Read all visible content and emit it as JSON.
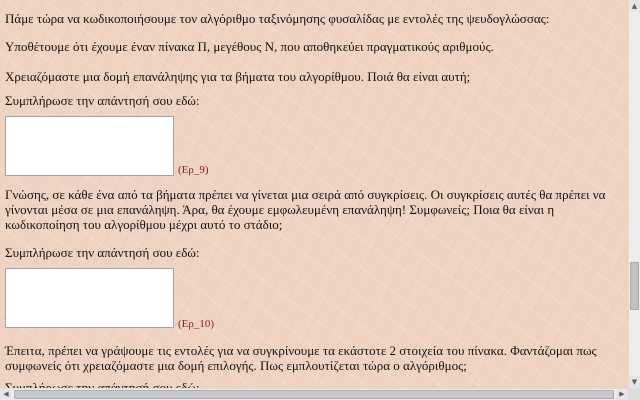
{
  "page": {
    "intro": "Πάμε τώρα να κωδικοποιήσουμε τον αλγόριθμο ταξινόμησης φυσαλίδας με εντολές της ψευδογλώσσας:",
    "assume": "Υποθέτουμε ότι έχουμε έναν πίνακα Π, μεγέθους Ν, που αποθηκεύει πραγματικούς αριθμούς.",
    "question1": "Χρειαζόμαστε μια δομή επανάληψης για τα βήματα του αλγορίθμου. Ποιά θα είναι αυτή;",
    "prompt1": "Συμπλήρωσε την απάντησή σου εδώ:",
    "ref1": "(Ερ_9)",
    "explanation": "Γνώσης, σε κάθε ένα από τα βήματα πρέπει να γίνεται μια σειρά από συγκρίσεις. Οι συγκρίσεις αυτές θα πρέπει να γίνονται μέσα σε μια επανάληψη. Άρα, θα έχουμε εμφωλευμένη επανάληψη! Συμφωνείς; Ποια θα είναι η κωδικοποίηση του αλγορίθμου μέχρι αυτό το στάδιο;",
    "prompt2": "Συμπλήρωσε την απάντησή σου εδώ:",
    "ref2": "(Ερ_10)",
    "next": "Έπειτα, πρέπει να γράψουμε τις εντολές για να συγκρίνουμε τα εκάστοτε 2 στοιχεία του πίνακα. Φαντάζομαι πως συμφωνείς ότι χρειαζόμαστε μια δομή επιλογής. Πως εμπλουτίζεται τώρα ο αλγόριθμος;",
    "prompt3": "Συμπλήρωσε την απάντησή σου εδώ:"
  },
  "answers": {
    "answer1": "",
    "answer2": ""
  },
  "scrollbar": {
    "up_icon": "arrow-up-icon",
    "down_icon": "arrow-down-icon",
    "left_icon": "arrow-left-icon",
    "right_icon": "arrow-right-icon",
    "up_glyph": "▲",
    "down_glyph": "▼",
    "left_glyph": "◀",
    "right_glyph": "▶"
  },
  "colors": {
    "background": "#efd3c2",
    "reference_text": "#8b1a1a"
  }
}
